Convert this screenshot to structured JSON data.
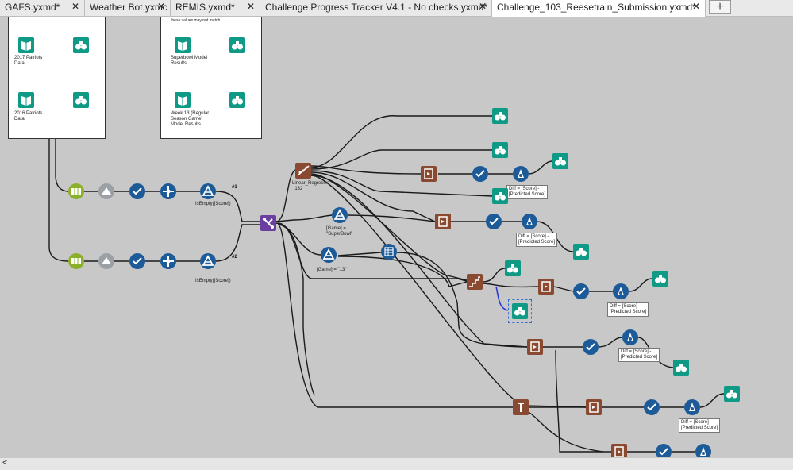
{
  "tabs": [
    {
      "label": "GAFS.yxmd*"
    },
    {
      "label": "Weather Bot.yxmc"
    },
    {
      "label": "REMIS.yxmd*"
    },
    {
      "label": "Challenge Progress Tracker V4.1 - No checks.yxmd*"
    },
    {
      "label": "Challenge_103_Reesetrain_Submission.yxmd*"
    }
  ],
  "tab_close_glyph": "✕",
  "tab_add_glyph": "+",
  "containers": {
    "left": {
      "input_2017_label": "2017 Patriots\nData",
      "input_2016_label": "2016 Patriots\nData"
    },
    "right": {
      "header_note": "these values may not match",
      "superbowl_label": "Superbowl Model\nResults",
      "week13_label": "Week 13 (Regular\nSeason Game)\nModel Results"
    }
  },
  "annotations": {
    "filter_isempty_1": "IsEmpty([Score])",
    "filter_isempty_2": "IsEmpty([Score])",
    "anchor_1": "#1",
    "anchor_2": "#2",
    "linear_regression": "Linear_Regressio\n_132",
    "filter_superbowl": "[Game] =\n\"SuperBowl\"",
    "filter_13": "[Game] = \"13\"",
    "formula_1": "Diff = [Score] -\n[Predicted Score]",
    "formula_2": "Diff = [Score] -\n[Predicted Score]",
    "formula_3": "Diff = [Score] -\n[Predicted Score]",
    "formula_4": "Diff = [Score] -\n[Predicted Score]",
    "formula_5": "Diff = [Score] -\n[Predicted Score]"
  },
  "scrollbar": {
    "left_arrow": "<"
  },
  "colors": {
    "canvas_bg": "#c8c8c8",
    "browse_teal": "#0f9a86",
    "input_teal": "#0f9a86",
    "prep_blue": "#1d5a98",
    "parse_green": "#8bb02a",
    "join_purple": "#6a3fa0",
    "model_brown": "#8a4a32",
    "gray_tool": "#9aa0a6",
    "selection_blue": "#2a6fd6",
    "connector": "#1a1a1a"
  },
  "icons": [
    "browse-icon",
    "input-data-icon",
    "select-icon",
    "filter-icon",
    "formula-icon",
    "union-icon",
    "join-icon",
    "score-icon",
    "linear-regression-icon",
    "sample-icon",
    "crosstab-icon",
    "summarize-icon",
    "text-to-columns-icon",
    "append-icon"
  ]
}
